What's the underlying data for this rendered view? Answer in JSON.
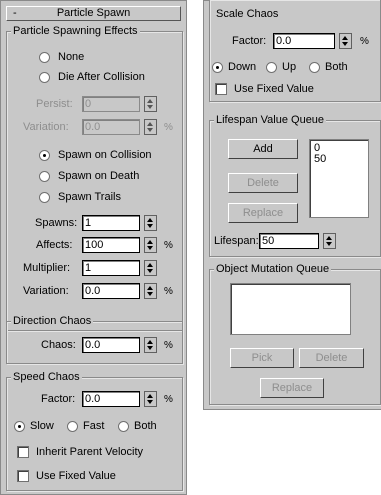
{
  "particle_spawn": {
    "title": "Particle Spawn",
    "collapse_symbol": "-",
    "effects": {
      "label": "Particle Spawning Effects",
      "none_label": "None",
      "die_after_collision_label": "Die After Collision",
      "persist_label": "Persist:",
      "persist_value": "0",
      "variation_label": "Variation:",
      "variation_value": "0.0",
      "variation_unit": "%",
      "spawn_on_collision_label": "Spawn on Collision",
      "spawn_on_death_label": "Spawn on Death",
      "spawn_trails_label": "Spawn Trails",
      "selected_mode": "Spawn on Collision",
      "spawns_label": "Spawns:",
      "spawns_value": "1",
      "affects_label": "Affects:",
      "affects_value": "100",
      "affects_unit": "%",
      "multiplier_label": "Multiplier:",
      "multiplier_value": "1",
      "variation2_label": "Variation:",
      "variation2_value": "0.0",
      "variation2_unit": "%"
    },
    "direction_chaos": {
      "label": "Direction Chaos",
      "chaos_label": "Chaos:",
      "chaos_value": "0.0",
      "chaos_unit": "%"
    },
    "speed_chaos": {
      "label": "Speed Chaos",
      "factor_label": "Factor:",
      "factor_value": "0.0",
      "factor_unit": "%",
      "slow_label": "Slow",
      "fast_label": "Fast",
      "both_label": "Both",
      "selected": "Slow",
      "inherit_label": "Inherit Parent Velocity",
      "fixed_label": "Use Fixed Value"
    }
  },
  "scale_chaos": {
    "label": "Scale Chaos",
    "factor_label": "Factor:",
    "factor_value": "0.0",
    "factor_unit": "%",
    "down_label": "Down",
    "up_label": "Up",
    "both_label": "Both",
    "selected": "Down",
    "fixed_label": "Use Fixed Value"
  },
  "lifespan_queue": {
    "label": "Lifespan Value Queue",
    "add_label": "Add",
    "delete_label": "Delete",
    "replace_label": "Replace",
    "items": [
      "0",
      "50"
    ],
    "lifespan_label": "Lifespan:",
    "lifespan_value": "50"
  },
  "mutation_queue": {
    "label": "Object Mutation Queue",
    "pick_label": "Pick",
    "delete_label": "Delete",
    "replace_label": "Replace"
  },
  "colors": {
    "panel_bg": "#c8c8c8",
    "disabled_text": "#8e8e8e"
  }
}
